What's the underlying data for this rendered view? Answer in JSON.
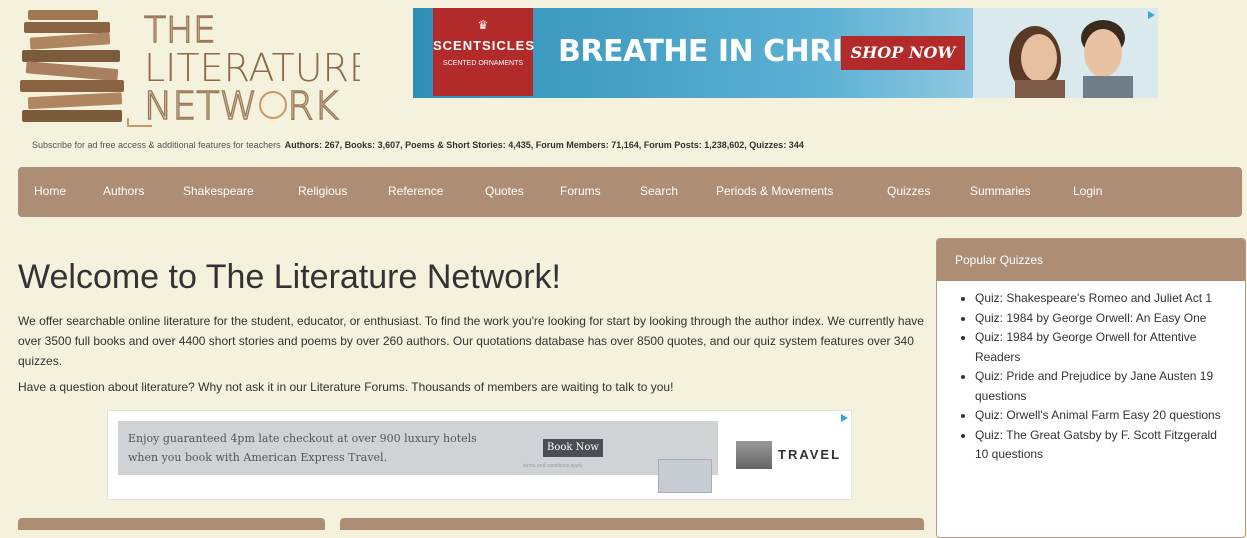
{
  "logo": {
    "line1": "THE",
    "line2": "LITERATURE",
    "line3": "NETW",
    "line3b": "RK"
  },
  "top_ad": {
    "brand": "SCENTSICLES",
    "brand_sub": "SCENTED ORNAMENTS",
    "headline": "BREATHE IN CHRISTMAS",
    "cta": "SHOP NOW"
  },
  "subscribe": {
    "text": "Subscribe for ad free access & additional features for teachers",
    "stats": "Authors: 267, Books: 3,607, Poems & Short Stories: 4,435, Forum Members: 71,164, Forum Posts: 1,238,602, Quizzes: 344"
  },
  "nav": {
    "items": [
      "Home",
      "Authors",
      "Shakespeare",
      "Religious",
      "Reference",
      "Quotes",
      "Forums",
      "Search",
      "Periods & Movements",
      "Quizzes",
      "Summaries",
      "Login"
    ]
  },
  "main": {
    "title": "Welcome to The Literature Network!",
    "intro": "We offer searchable online literature for the student, educator, or enthusiast. To find the work you're looking for start by looking through the author index. We currently have over 3500 full books and over 4400 short stories and poems by over 260 authors. Our quotations database has over 8500 quotes, and our quiz system features over 340 quizzes.",
    "question": "Have a question about literature? Why not ask it in our Literature Forums. Thousands of members are waiting to talk to you!"
  },
  "mid_ad": {
    "offer": "Enjoy guaranteed 4pm late checkout at over 900 luxury hotels when you book with American Express Travel.",
    "cta": "Book Now",
    "fine": "terms and conditions apply",
    "logo_text": "TRAVEL"
  },
  "sidebar": {
    "title": "Popular Quizzes",
    "items": [
      "Quiz: Shakespeare's Romeo and Juliet Act 1",
      "Quiz: 1984 by George Orwell: An Easy One",
      "Quiz: 1984 by George Orwell for Attentive Readers",
      "Quiz: Pride and Prejudice by Jane Austen 19 questions",
      "Quiz: Orwell's Animal Farm Easy 20 questions",
      "Quiz: The Great Gatsby by F. Scott Fitzgerald 10 questions"
    ]
  },
  "colors": {
    "background": "#f4f1dc",
    "nav": "#ad8e74",
    "logo": "#8b6b4a",
    "ad_red": "#b32a2a"
  }
}
